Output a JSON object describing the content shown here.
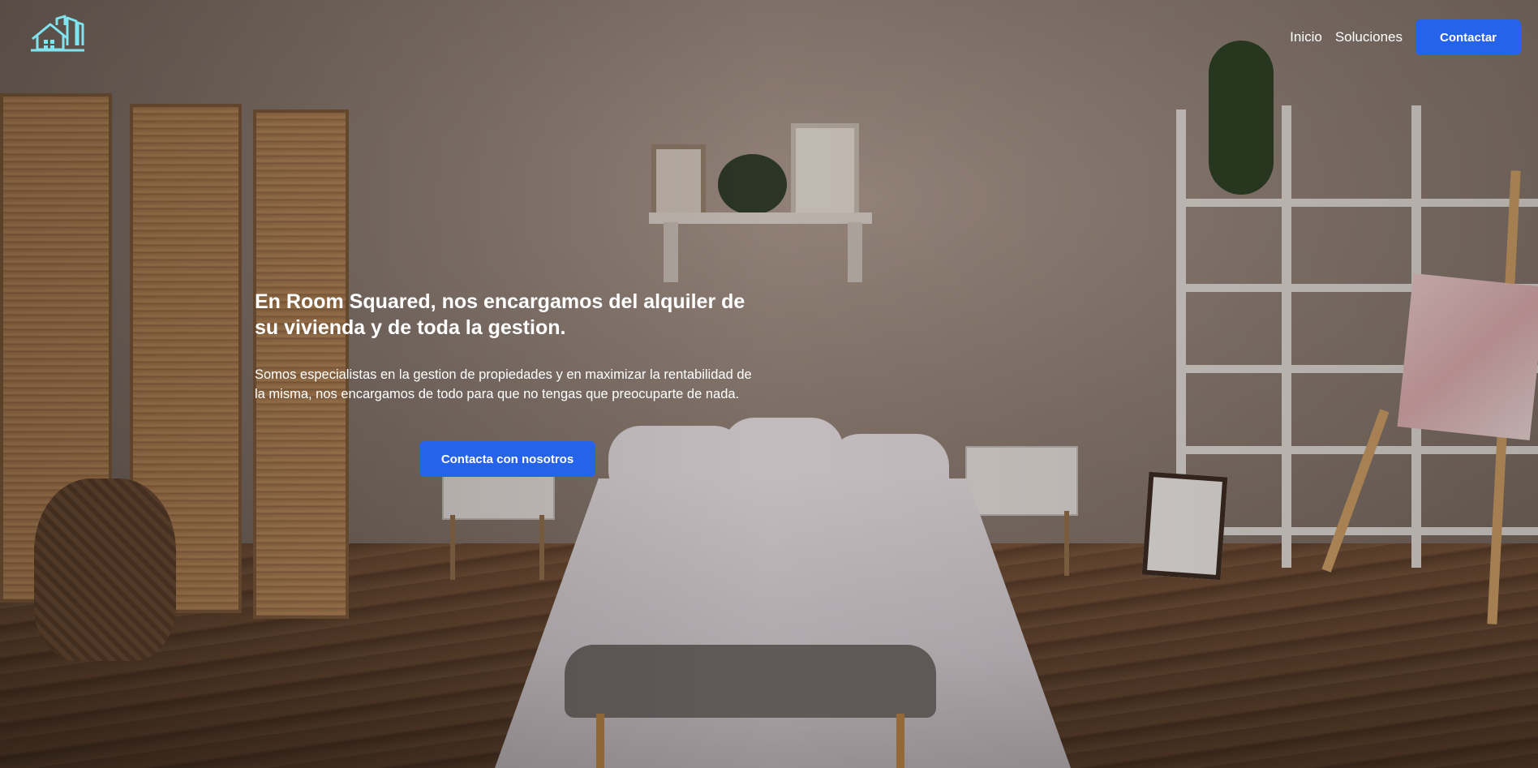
{
  "header": {
    "logo_icon": "house-buildings-logo",
    "nav": {
      "home_label": "Inicio",
      "solutions_label": "Soluciones",
      "contact_label": "Contactar"
    }
  },
  "hero": {
    "title": "En Room Squared, nos encargamos del alquiler de su vivienda y de toda la gestion.",
    "description": "Somos especialistas en la gestion de propiedades y en maximizar la rentabilidad de la misma, nos encargamos de todo para que no tengas que preocuparte de nada.",
    "cta_label": "Contacta con nosotros"
  },
  "colors": {
    "accent": "#2563eb",
    "logo": "#7fe3f0",
    "text": "#ffffff"
  }
}
